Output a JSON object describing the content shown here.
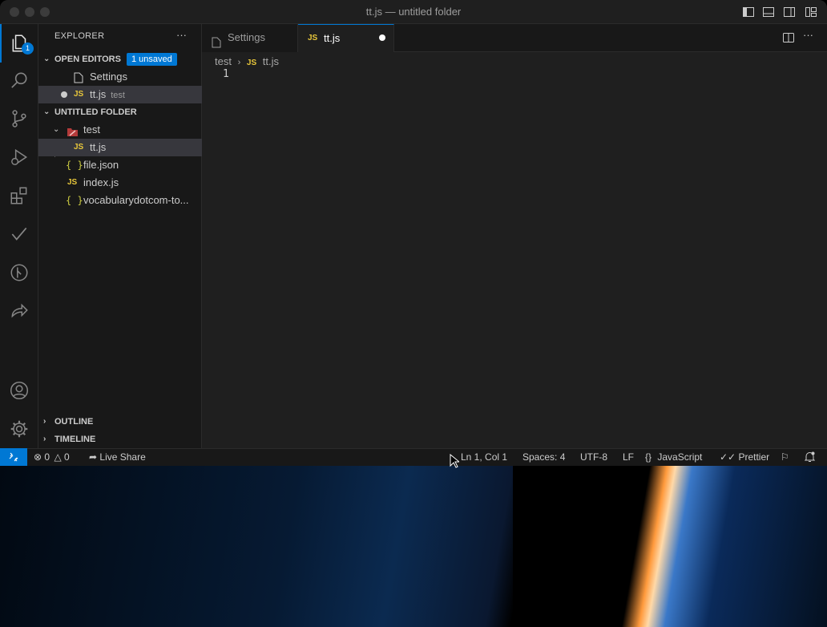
{
  "window": {
    "title": "tt.js — untitled folder"
  },
  "activity_bar": {
    "explorer_badge": "1"
  },
  "sidebar": {
    "header": "EXPLORER",
    "more": "···",
    "open_editors": {
      "label": "OPEN EDITORS",
      "badge": "1 unsaved",
      "items": [
        {
          "name": "Settings"
        },
        {
          "name": "tt.js",
          "description": "test",
          "icon": "JS"
        }
      ]
    },
    "folder": {
      "label": "UNTITLED FOLDER",
      "subfolder": "test",
      "items": [
        {
          "name": "tt.js",
          "icon": "JS"
        },
        {
          "name": "file.json",
          "icon": "{ }"
        },
        {
          "name": "index.js",
          "icon": "JS"
        },
        {
          "name": "vocabularydotcom-to...",
          "icon": "{ }"
        }
      ]
    },
    "outline_label": "OUTLINE",
    "timeline_label": "TIMELINE"
  },
  "tabs": [
    {
      "label": "Settings"
    },
    {
      "label": "tt.js",
      "icon": "JS"
    }
  ],
  "editor": {
    "breadcrumb_folder": "test",
    "breadcrumb_file": "tt.js",
    "breadcrumb_icon": "JS",
    "line_number": "1"
  },
  "status_bar": {
    "errors": "0",
    "warnings": "0",
    "live_share": "Live Share",
    "position": "Ln 1, Col 1",
    "spaces": "Spaces: 4",
    "encoding": "UTF-8",
    "eol": "LF",
    "language": "JavaScript",
    "formatter": "Prettier"
  },
  "colors": {
    "accent": "#0078d4",
    "js_icon": "#e8c73b",
    "json_icon": "#cbcb41"
  }
}
